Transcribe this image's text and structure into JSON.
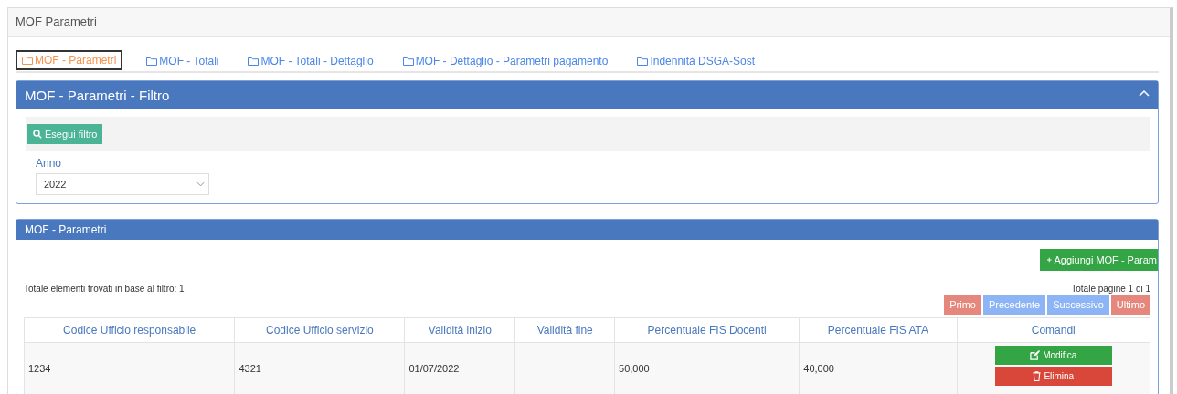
{
  "page_title": "MOF Parametri",
  "tabs": [
    {
      "label": "MOF - Parametri",
      "selected": true
    },
    {
      "label": "MOF - Totali",
      "selected": false
    },
    {
      "label": "MOF - Totali - Dettaglio",
      "selected": false
    },
    {
      "label": "MOF - Dettaglio - Parametri pagamento",
      "selected": false
    },
    {
      "label": "Indennità DSGA-Sost",
      "selected": false
    }
  ],
  "filter_panel": {
    "title": "MOF - Parametri - Filtro",
    "expanded": true,
    "run_button": "Esegui filtro",
    "year_label": "Anno",
    "year_value": "2022"
  },
  "list_panel": {
    "title": "MOF - Parametri",
    "add_button": "Aggiungi MOF - Param",
    "total_found": "Totale elementi trovati in base al filtro: 1",
    "pages": "Totale pagine 1 di 1",
    "pager": [
      {
        "label": "Primo",
        "kind": "edge"
      },
      {
        "label": "Precedente",
        "kind": "step"
      },
      {
        "label": "Successivo",
        "kind": "step"
      },
      {
        "label": "Ultimo",
        "kind": "edge"
      }
    ],
    "columns": [
      "Codice Ufficio responsabile",
      "Codice Ufficio servizio",
      "Validità inizio",
      "Validità fine",
      "Percentuale FIS Docenti",
      "Percentuale FIS ATA",
      "Comandi"
    ],
    "rows": [
      {
        "cells": [
          "1234",
          "4321",
          "01/07/2022",
          "",
          "50,000",
          "40,000"
        ],
        "edit_button": "Modifica",
        "delete_button": "Elimina"
      }
    ]
  }
}
